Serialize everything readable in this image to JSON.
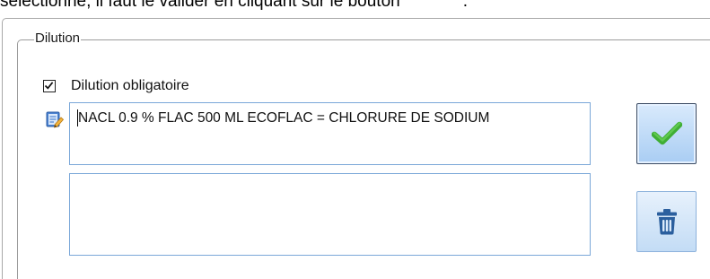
{
  "instruction_text": "sélectionné, il faut le valider en cliquant sur le bouton",
  "instruction_suffix": ".",
  "group": {
    "legend": "Dilution"
  },
  "checkbox": {
    "label": "Dilution obligatoire",
    "checked": true
  },
  "dilution_field": {
    "value": "NACL 0.9 % FLAC 500 ML ECOFLAC = CHLORURE DE SODIUM"
  },
  "secondary_field": {
    "value": ""
  },
  "icons": {
    "edit": "edit-note-icon",
    "validate": "checkmark-icon",
    "delete": "trash-icon"
  },
  "colors": {
    "checkmark_green": "#3fae34",
    "trash_blue": "#2b5f9e",
    "field_border": "#7aa7d8"
  }
}
